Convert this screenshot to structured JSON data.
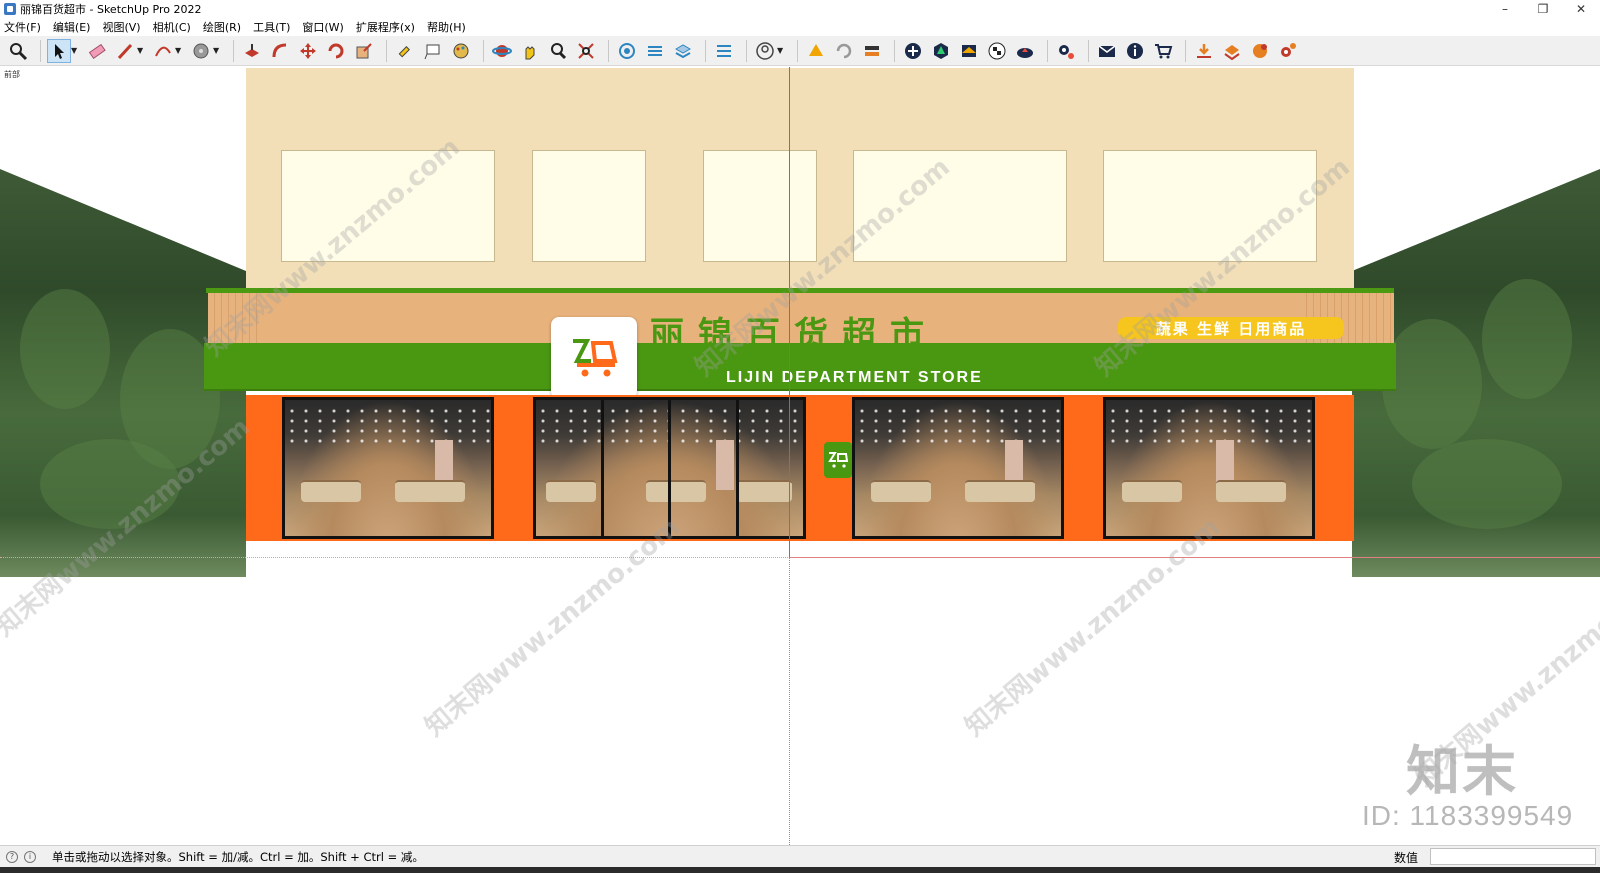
{
  "window": {
    "title": "丽锦百货超市 - SketchUp Pro 2022",
    "controls": {
      "minimize": "–",
      "restore": "❐",
      "close": "✕"
    }
  },
  "menu": {
    "items": [
      "文件(F)",
      "编辑(E)",
      "视图(V)",
      "相机(C)",
      "绘图(R)",
      "工具(T)",
      "窗口(W)",
      "扩展程序(x)",
      "帮助(H)"
    ]
  },
  "toolbar": {
    "icons": [
      "zoom-icon",
      "select-icon",
      "eraser-icon",
      "pencil-icon",
      "arc-icon",
      "paint-bucket-icon",
      "push-pull-icon",
      "offset-icon",
      "move-icon",
      "rotate-icon",
      "scale-icon",
      "tape-measure-icon",
      "text-icon",
      "paint-icon",
      "orbit-icon",
      "pan-icon",
      "zoom-window-icon",
      "zoom-extents-icon",
      "warehouse-icon",
      "extension-icon",
      "layers-icon",
      "outliner-icon",
      "profile-icon",
      "sync-icon",
      "refresh-icon",
      "export-icon",
      "add-icon",
      "tree-icon",
      "section-icon",
      "checker-icon",
      "cloud-icon",
      "settings-icon",
      "mail-icon",
      "info-icon",
      "cart-icon",
      "download-icon",
      "upload-icon",
      "plugin-icon",
      "gear-icon"
    ]
  },
  "viewport": {
    "scene_label": "前部",
    "store": {
      "name_cn": "丽锦百货超市",
      "name_en": "LIJIN DEPARTMENT STORE",
      "tagline": "蔬果 生鲜 日用商品"
    },
    "watermark": {
      "text": "知末网www.znzmo.com",
      "logo": "知末",
      "id": "ID: 1183399549"
    }
  },
  "status": {
    "message": "单击或拖动以选择对象。Shift = 加/减。Ctrl = 加。Shift + Ctrl = 减。",
    "vcb_label": "数值",
    "vcb_value": ""
  },
  "colors": {
    "green": "#4a9712",
    "orange": "#ff6a1a",
    "beige": "#f2dfb8",
    "yellow": "#f6c51e"
  }
}
